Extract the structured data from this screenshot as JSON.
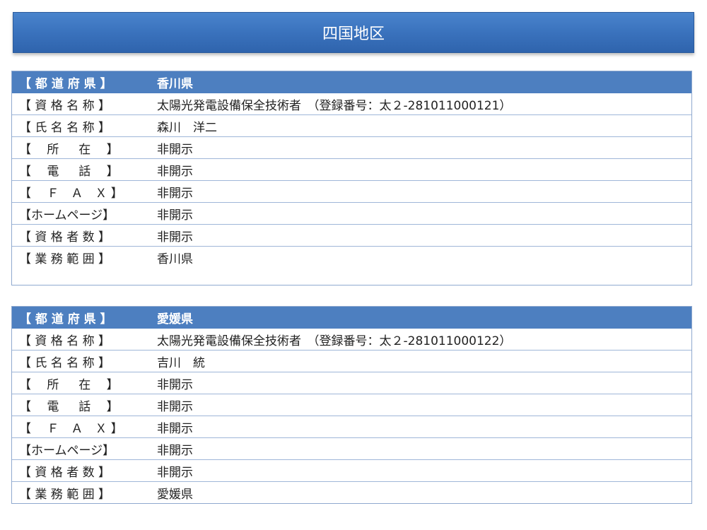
{
  "title": "四国地区",
  "cards": [
    {
      "rows": [
        {
          "label": "【 都 道 府 県 】",
          "value": "香川県"
        },
        {
          "label": "【 資 格 名 称 】",
          "value": "太陽光発電設備保全技術者　（登録番号：太２-281011000121）"
        },
        {
          "label": "【 氏 名 名 称 】",
          "value": "森川　洋二"
        },
        {
          "label": "【　 所 　 在 　】",
          "value": "非開示"
        },
        {
          "label": "【　 電 　 話 　】",
          "value": "非開示"
        },
        {
          "label": "【 　Ｆ　Ａ　Ｘ 】",
          "value": "非開示"
        },
        {
          "label": "【ホームページ】",
          "value": "非開示"
        },
        {
          "label": "【 資 格 者 数 】",
          "value": "非開示"
        },
        {
          "label": "【 業 務 範 囲 】",
          "value": "香川県"
        }
      ]
    },
    {
      "rows": [
        {
          "label": "【 都 道 府 県 】",
          "value": "愛媛県"
        },
        {
          "label": "【 資 格 名 称 】",
          "value": "太陽光発電設備保全技術者　（登録番号：太２-281011000122）"
        },
        {
          "label": "【 氏 名 名 称 】",
          "value": "吉川　統"
        },
        {
          "label": "【　 所 　 在 　】",
          "value": "非開示"
        },
        {
          "label": "【　 電 　 話 　】",
          "value": "非開示"
        },
        {
          "label": "【 　Ｆ　Ａ　Ｘ 】",
          "value": "非開示"
        },
        {
          "label": "【ホームページ】",
          "value": "非開示"
        },
        {
          "label": "【 資 格 者 数 】",
          "value": "非開示"
        },
        {
          "label": "【 業 務 範 囲 】",
          "value": "愛媛県"
        }
      ]
    }
  ]
}
